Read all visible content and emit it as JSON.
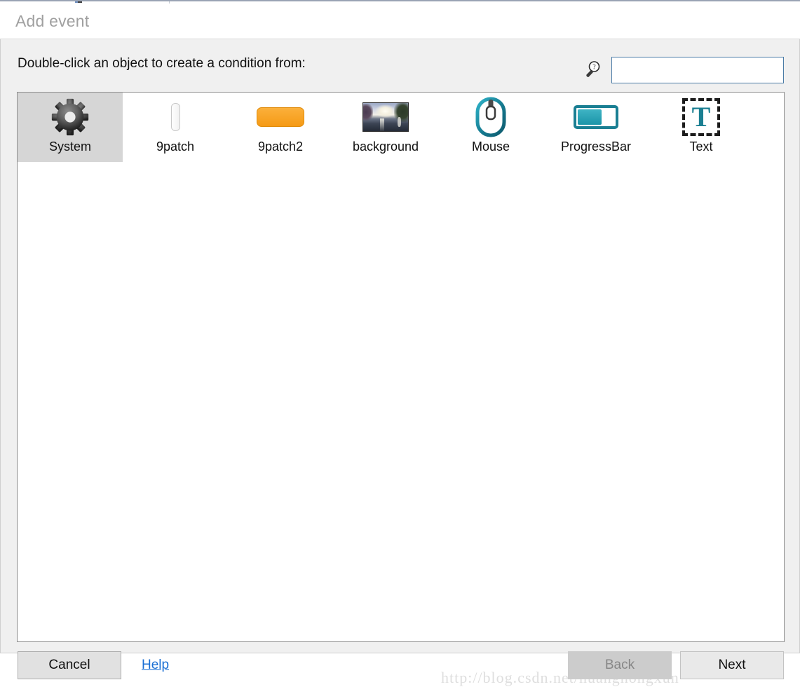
{
  "window": {
    "title": "Add event"
  },
  "header": {
    "prompt": "Double-click an object to create a condition from:",
    "search_icon": "magnifier-question-icon",
    "search_value": "",
    "search_placeholder": ""
  },
  "objects": [
    {
      "label": "System",
      "icon": "gear-icon",
      "selected": true
    },
    {
      "label": "9patch",
      "icon": "9patch-slim-icon",
      "selected": false
    },
    {
      "label": "9patch2",
      "icon": "9patch-orange-icon",
      "selected": false
    },
    {
      "label": "background",
      "icon": "photo-thumbnail-icon",
      "selected": false
    },
    {
      "label": "Mouse",
      "icon": "mouse-icon",
      "selected": false
    },
    {
      "label": "ProgressBar",
      "icon": "progressbar-icon",
      "selected": false
    },
    {
      "label": "Text",
      "icon": "text-t-icon",
      "selected": false
    }
  ],
  "footer": {
    "cancel_label": "Cancel",
    "help_label": "Help",
    "back_label": "Back",
    "next_label": "Next",
    "back_disabled": true
  },
  "watermark": "http://blog.csdn.net/huanghongxun",
  "colors": {
    "accent_teal": "#1a7f93",
    "link_blue": "#1a6fd4",
    "selection_gray": "#d6d6d6",
    "dialog_bg": "#f0f0f0",
    "focus_border": "#4a7ba6",
    "orange": "#f59a15"
  }
}
